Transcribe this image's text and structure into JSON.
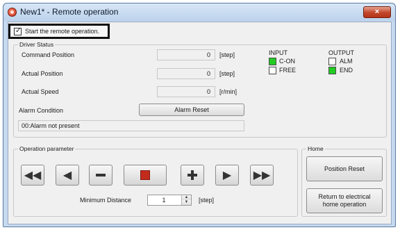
{
  "window": {
    "title": "New1* - Remote operation",
    "close_icon": "close-x",
    "close_label": "×"
  },
  "start": {
    "label": "Start the remote operation.",
    "checked": true
  },
  "driver_status": {
    "title": "Driver Status",
    "command_position": {
      "label": "Command Position",
      "value": "0",
      "unit": "[step]"
    },
    "actual_position": {
      "label": "Actual Position",
      "value": "0",
      "unit": "[step]"
    },
    "actual_speed": {
      "label": "Actual Speed",
      "value": "0",
      "unit": "[r/min]"
    },
    "alarm_condition_label": "Alarm Condition",
    "alarm_reset_label": "Alarm Reset",
    "alarm_message": "00:Alarm not present"
  },
  "io": {
    "input_title": "INPUT",
    "output_title": "OUTPUT",
    "inputs": [
      {
        "label": "C-ON",
        "on": true
      },
      {
        "label": "FREE",
        "on": false
      }
    ],
    "outputs": [
      {
        "label": "ALM",
        "on": false
      },
      {
        "label": "END",
        "on": true
      }
    ],
    "on_color": "#22cc22"
  },
  "operation": {
    "title": "Operation parameter",
    "buttons": [
      "fast-reverse-icon",
      "reverse-icon",
      "minus-icon",
      "stop-icon",
      "plus-icon",
      "forward-icon",
      "fast-forward-icon"
    ],
    "min_distance_label": "Minimum Distance",
    "min_distance_value": "1",
    "min_distance_unit": "[step]"
  },
  "home": {
    "title": "Home",
    "position_reset_label": "Position Reset",
    "return_home_label": "Return to electrical home operation"
  }
}
